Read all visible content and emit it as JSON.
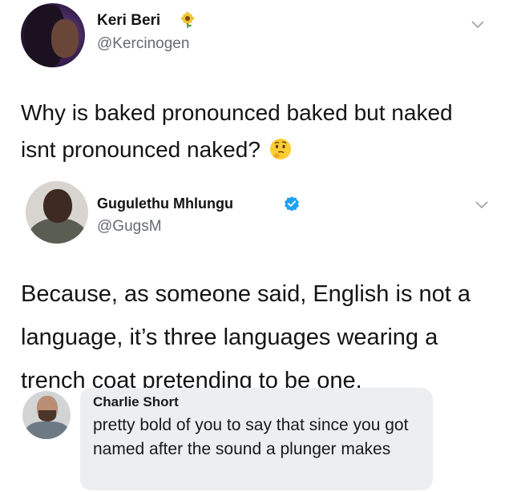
{
  "tweets": [
    {
      "name": "Keri Beri",
      "handle": "@Kercinogen",
      "text": "Why is baked pronounced baked but naked isnt pronounced naked?",
      "name_emoji_icon": "sunflower-icon",
      "text_emoji_icon": "thinking-face-icon"
    },
    {
      "name": "Gugulethu Mhlungu",
      "handle": "@GugsM",
      "text": "Because, as someone said, English is not a language, it’s three languages wearing a trench coat pretending to be one.",
      "badge_icon": "verified-badge-icon",
      "verified_color": "#1da1f2"
    }
  ],
  "reply": {
    "name": "Charlie Short",
    "text": "pretty bold of you to say that since you got named after the sound a plunger makes"
  }
}
